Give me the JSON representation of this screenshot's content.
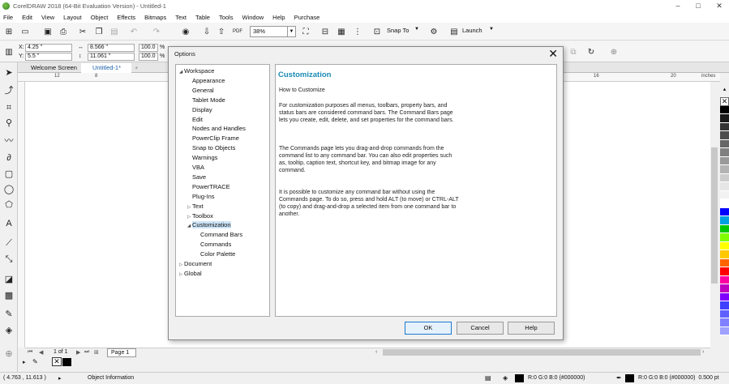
{
  "window": {
    "title": "CorelDRAW 2018 (64-Bit Evaluation Version) - Untitled-1",
    "controls": {
      "minimize": "–",
      "maximize": "□",
      "close": "✕"
    }
  },
  "menu": [
    "File",
    "Edit",
    "View",
    "Layout",
    "Object",
    "Effects",
    "Bitmaps",
    "Text",
    "Table",
    "Tools",
    "Window",
    "Help",
    "Purchase"
  ],
  "toolbar": {
    "zoom_value": "38%",
    "snap_to_label": "Snap To",
    "launch_label": "Launch"
  },
  "property_bar": {
    "x_label": "X:",
    "x_value": "4.25 \"",
    "y_label": "Y:",
    "y_value": "5.5 \"",
    "w_value": "8.566 \"",
    "h_value": "11.061 \"",
    "scale_w": "100.0",
    "scale_h": "100.0",
    "pct": "%"
  },
  "doc_tabs": [
    "Welcome Screen",
    "Untitled-1*"
  ],
  "ruler": {
    "units": "inches",
    "h_numbers_left": [
      "12",
      "8"
    ],
    "h_numbers_right": [
      "16",
      "20"
    ]
  },
  "page_nav": {
    "page_info": "1 of 1",
    "page_tab": "Page 1"
  },
  "status": {
    "coords": "( 4.763 , 11.613 )",
    "object_info": "Object Information",
    "fill_info": "R:0 G:0 B:0 (#000000)",
    "outline_info": "R:0 G:0 B:0 (#000000)  0.500 pt"
  },
  "palette_colors": [
    "#ffffff",
    "#000000",
    "#1a1a1a",
    "#333333",
    "#4d4d4d",
    "#666666",
    "#808080",
    "#999999",
    "#b3b3b3",
    "#cccccc",
    "#e6e6e6",
    "#f2f2f2",
    "#ffffff",
    "#0000ff",
    "#00a0e0",
    "#00c800",
    "#80ff00",
    "#ffff00",
    "#ffc800",
    "#ff6400",
    "#ff0000",
    "#ff00a0",
    "#c000c0",
    "#8000ff",
    "#4040ff",
    "#6060ff",
    "#8080ff",
    "#a0a0ff"
  ],
  "dialog": {
    "title": "Options",
    "tree": [
      {
        "label": "Workspace",
        "level": 0,
        "expander": "◢"
      },
      {
        "label": "Appearance",
        "level": 1
      },
      {
        "label": "General",
        "level": 1
      },
      {
        "label": "Tablet Mode",
        "level": 1
      },
      {
        "label": "Display",
        "level": 1
      },
      {
        "label": "Edit",
        "level": 1
      },
      {
        "label": "Nodes and Handles",
        "level": 1
      },
      {
        "label": "PowerClip Frame",
        "level": 1
      },
      {
        "label": "Snap to Objects",
        "level": 1
      },
      {
        "label": "Warnings",
        "level": 1
      },
      {
        "label": "VBA",
        "level": 1
      },
      {
        "label": "Save",
        "level": 1
      },
      {
        "label": "PowerTRACE",
        "level": 1
      },
      {
        "label": "Plug-Ins",
        "level": 1
      },
      {
        "label": "Text",
        "level": 1,
        "expander": "▷"
      },
      {
        "label": "Toolbox",
        "level": 1,
        "expander": "▷"
      },
      {
        "label": "Customization",
        "level": 1,
        "expander": "◢",
        "selected": true
      },
      {
        "label": "Command Bars",
        "level": 2
      },
      {
        "label": "Commands",
        "level": 2
      },
      {
        "label": "Color Palette",
        "level": 2
      },
      {
        "label": "Document",
        "level": 0,
        "expander": "▷"
      },
      {
        "label": "Global",
        "level": 0,
        "expander": "▷"
      }
    ],
    "heading": "Customization",
    "subheading": "How to Customize",
    "paragraphs": [
      "For customization purposes all menus, toolbars, property bars, and status bars are considered command bars. The Command Bars page lets you create, edit, delete, and set properties for the command bars.",
      "The Commands page lets you drag-and-drop commands from the command list to any command bar. You can also edit properties such as, tooltip, caption text, shortcut key, and bitmap image for any command.",
      "It is possible to customize any command bar without using the Commands page. To do so, press and hold ALT (to move) or CTRL-ALT (to copy) and drag-and-drop a selected item from one command bar to another."
    ],
    "buttons": {
      "ok": "OK",
      "cancel": "Cancel",
      "help": "Help"
    }
  }
}
